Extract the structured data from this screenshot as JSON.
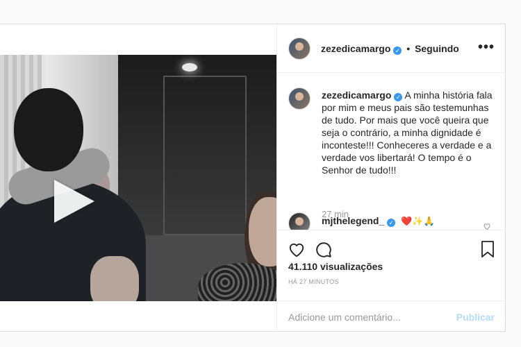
{
  "post": {
    "username": "zezedicamargo",
    "follow_separator": "•",
    "follow_status": "Seguindo",
    "more_label": "•••",
    "play_icon": "play-icon",
    "caption": "A minha história fala por mim e meus pais são testemunhas de tudo. Por mais que você queira que seja o contrário, a minha dignidade é inconteste!!! Conheceres a verdade e a verdade vos libertará! O tempo é o Senhor de tudo!!!",
    "caption_time": "27 min",
    "reply": {
      "username": "mjthelegend_",
      "emojis": "❤️✨🙏"
    },
    "views": "41.110 visualizações",
    "posted_ago": "HÁ 27 MINUTOS",
    "comment_placeholder": "Adicione um comentário...",
    "publish_label": "Publicar"
  },
  "colors": {
    "verified": "#3897f0",
    "publish_disabled": "#b3dbff",
    "muted": "#999999"
  }
}
